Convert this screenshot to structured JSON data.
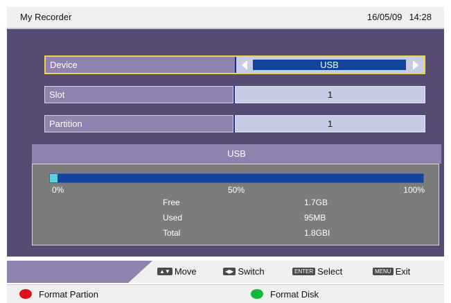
{
  "header": {
    "title": "My Recorder",
    "date": "16/05/09",
    "time": "14:28"
  },
  "settings": [
    {
      "label": "Device",
      "value": "USB",
      "focused": true
    },
    {
      "label": "Slot",
      "value": "1",
      "focused": false
    },
    {
      "label": "Partition",
      "value": "1",
      "focused": false
    }
  ],
  "storage": {
    "title": "USB",
    "usage_fraction": 0.02,
    "scale": {
      "min": "0%",
      "mid": "50%",
      "max": "100%"
    },
    "stats": [
      {
        "name": "Free",
        "value": "1.7GB"
      },
      {
        "name": "Used",
        "value": "95MB"
      },
      {
        "name": "Total",
        "value": "1.8GBI"
      }
    ]
  },
  "hints": {
    "move_key": "▲▼",
    "move": "Move",
    "switch_key": "◀▶",
    "switch": "Switch",
    "select_key": "ENTER",
    "select": "Select",
    "exit_key": "MENU",
    "exit": "Exit"
  },
  "color_buttons": {
    "red_label": "Format Partion",
    "green_label": "Format Disk",
    "red_color": "#e0101a",
    "green_color": "#13b838"
  },
  "colors": {
    "background": "#574b73",
    "label_bg": "#8f82af",
    "value_bg": "#c6cbe6",
    "focus_border": "#e9d64c",
    "bar_bg": "#11449a",
    "bar_fill": "#5ed0d8"
  }
}
